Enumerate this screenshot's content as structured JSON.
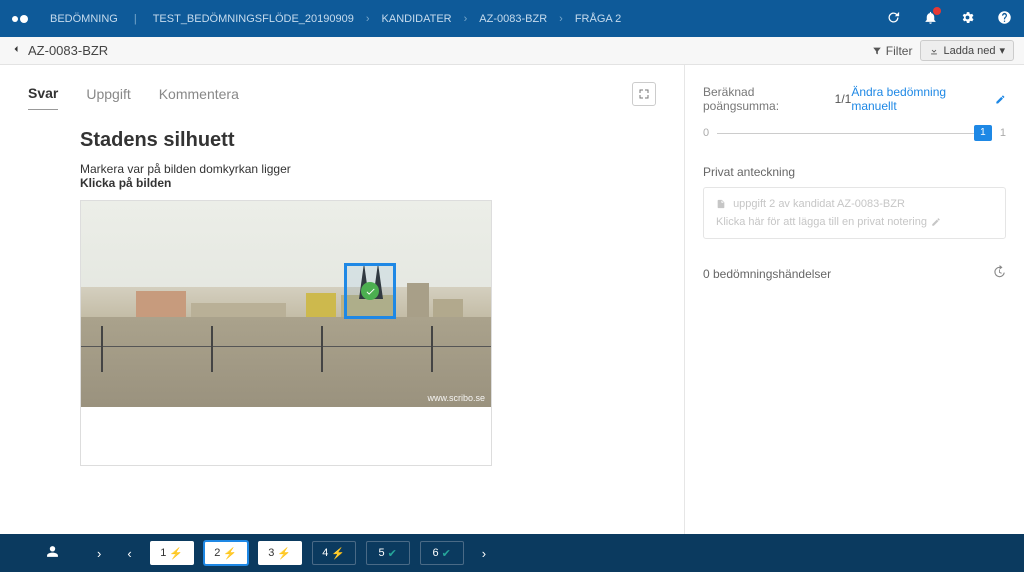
{
  "breadcrumb": {
    "root": "BEDÖMNING",
    "flow": "TEST_BEDÖMNINGSFLÖDE_20190909",
    "section": "KANDIDATER",
    "candidate": "AZ-0083-BZR",
    "question": "FRÅGA 2"
  },
  "subheader": {
    "title": "AZ-0083-BZR",
    "filter": "Filter",
    "download": "Ladda ned"
  },
  "tabs": {
    "svar": "Svar",
    "uppgift": "Uppgift",
    "kommentera": "Kommentera"
  },
  "question": {
    "title": "Stadens silhuett",
    "instr_line1": "Markera var på bilden domkyrkan ligger",
    "instr_line2": "Klicka på bilden",
    "watermark": "www.scribo.se"
  },
  "right": {
    "score_label": "Beräknad poängsumma:",
    "score_value": "1/1",
    "manual_link": "Ändra bedömning manuellt",
    "slider_min": "0",
    "slider_val": "1",
    "slider_max": "1",
    "priv_title": "Privat anteckning",
    "priv_line1": "uppgift 2 av kandidat AZ-0083-BZR",
    "priv_line2": "Klicka här för att lägga till en privat notering",
    "events": "0 bedömningshändelser"
  },
  "bottom": {
    "questions": [
      {
        "n": "1",
        "status": "bolt",
        "style": "white"
      },
      {
        "n": "2",
        "status": "bolt",
        "style": "white",
        "active": true
      },
      {
        "n": "3",
        "status": "bolt",
        "style": "white"
      },
      {
        "n": "4",
        "status": "bolt",
        "style": "blue"
      },
      {
        "n": "5",
        "status": "ok",
        "style": "blue"
      },
      {
        "n": "6",
        "status": "ok",
        "style": "blue"
      }
    ]
  }
}
